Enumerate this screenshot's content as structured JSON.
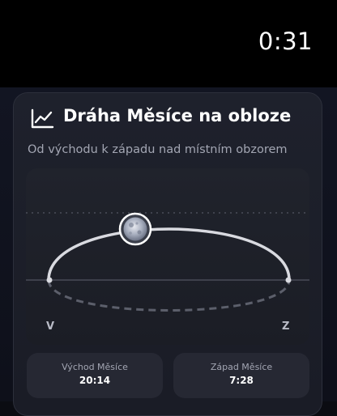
{
  "status_bar": {
    "time": "0:31"
  },
  "card": {
    "icon": "line-chart-icon",
    "title": "Dráha Měsíce na obloze",
    "subtitle": "Od východu k západu nad místním obzorem"
  },
  "sky": {
    "east_label": "V",
    "west_label": "Z",
    "moon_progress": 0.43,
    "icon": "moon-icon"
  },
  "times": {
    "rise_label": "Východ Měsíce",
    "rise_value": "20:14",
    "set_label": "Západ Měsíce",
    "set_value": "7:28"
  },
  "colors": {
    "background": "#0b0c12",
    "card": "#1e212c",
    "arc": "#d9dae0",
    "muted_text": "#a3a6b3"
  }
}
